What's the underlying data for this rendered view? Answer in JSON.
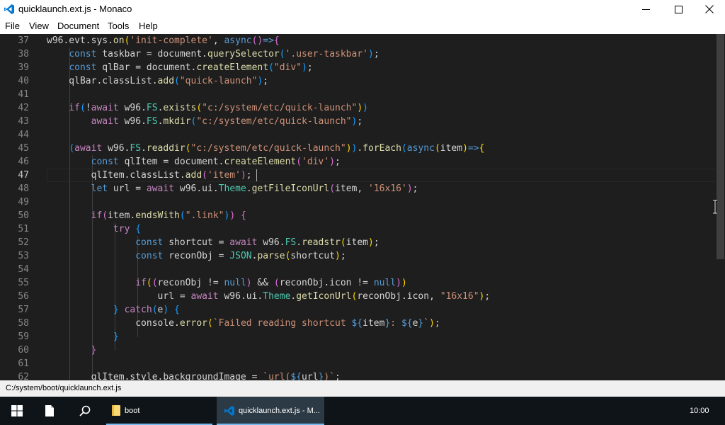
{
  "window": {
    "title": "quicklaunch.ext.js - Monaco"
  },
  "menu": [
    "File",
    "View",
    "Document",
    "Tools",
    "Help"
  ],
  "editor": {
    "line_numbers": [
      "37",
      "38",
      "39",
      "40",
      "41",
      "42",
      "43",
      "44",
      "45",
      "46",
      "47",
      "48",
      "49",
      "50",
      "51",
      "52",
      "53",
      "54",
      "55",
      "56",
      "57",
      "58",
      "59",
      "60",
      "61",
      "62"
    ],
    "current_line": "47"
  },
  "status": {
    "path": "C:/system/boot/quicklaunch.ext.js"
  },
  "taskbar": {
    "tasks": [
      {
        "label": "boot",
        "icon": "folder-icon"
      },
      {
        "label": "quicklaunch.ext.js - M...",
        "icon": "vscode-icon"
      }
    ],
    "clock": "10:00"
  },
  "colors": {
    "keyword": "#569cd6",
    "control": "#c586c0",
    "string": "#ce9178",
    "type": "#4ec9b0",
    "function": "#dcdcaa",
    "accent": "#0078d4"
  }
}
